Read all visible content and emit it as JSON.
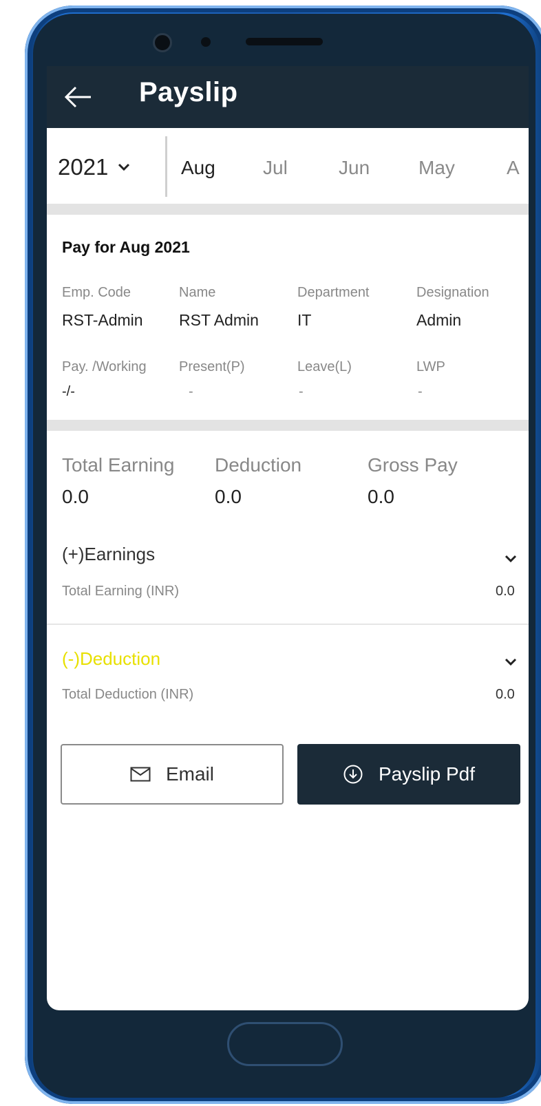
{
  "header": {
    "title": "Payslip"
  },
  "selector": {
    "year": "2021",
    "months": [
      "Aug",
      "Jul",
      "Jun",
      "May",
      "A"
    ],
    "active_month": "Aug"
  },
  "pay": {
    "title": "Pay for Aug 2021",
    "fields": [
      {
        "label": "Emp. Code",
        "value": "RST-Admin"
      },
      {
        "label": "Name",
        "value": "RST Admin"
      },
      {
        "label": "Department",
        "value": "IT"
      },
      {
        "label": "Designation",
        "value": "Admin"
      }
    ],
    "attendance": [
      {
        "label": "Pay. /Working",
        "value": "-/-"
      },
      {
        "label": "Present(P)",
        "value": "-"
      },
      {
        "label": "Leave(L)",
        "value": "-"
      },
      {
        "label": "LWP",
        "value": "-"
      }
    ]
  },
  "summary": [
    {
      "label": "Total Earning",
      "value": "0.0"
    },
    {
      "label": "Deduction",
      "value": "0.0"
    },
    {
      "label": "Gross Pay",
      "value": "0.0"
    }
  ],
  "earnings": {
    "title": "(+)Earnings",
    "total_label": "Total Earning (INR)",
    "total_value": "0.0"
  },
  "deduction": {
    "title": "(-)Deduction",
    "total_label": "Total Deduction (INR)",
    "total_value": "0.0",
    "title_color": "#e8e000"
  },
  "actions": {
    "email_label": "Email",
    "pdf_label": "Payslip Pdf"
  },
  "colors": {
    "appbar": "#1b2b38",
    "frame": "#1f6fd0"
  }
}
